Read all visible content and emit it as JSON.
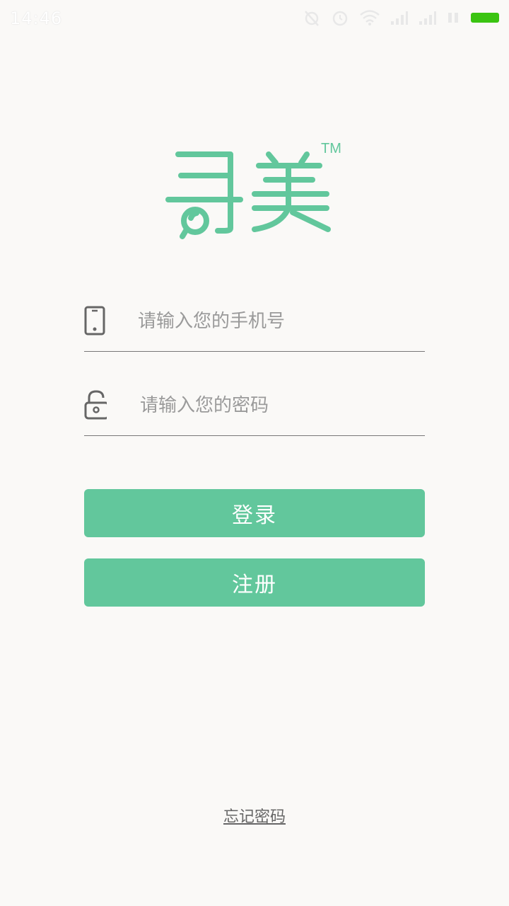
{
  "status_bar": {
    "time": "14:46",
    "battery_color": "#3ac411"
  },
  "logo": {
    "text": "寻美",
    "trademark": "TM",
    "color": "#62c79c"
  },
  "form": {
    "phone": {
      "placeholder": "请输入您的手机号",
      "value": "",
      "icon": "phone-icon"
    },
    "password": {
      "placeholder": "请输入您的密码",
      "value": "",
      "icon": "unlock-icon"
    }
  },
  "buttons": {
    "login_label": "登录",
    "register_label": "注册",
    "color": "#62c79c"
  },
  "footer": {
    "forgot_label": "忘记密码"
  }
}
